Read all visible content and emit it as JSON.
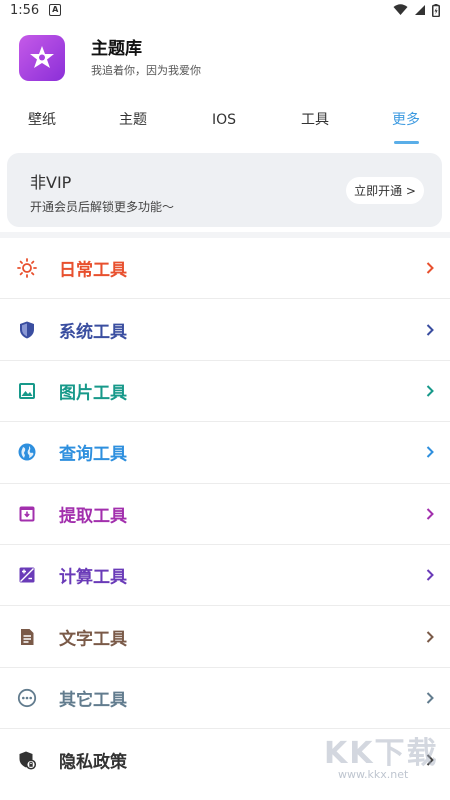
{
  "status_bar": {
    "time": "1:56"
  },
  "app": {
    "title": "主题库",
    "subtitle": "我追着你，因为我爱你"
  },
  "tabs": [
    {
      "label": "壁纸",
      "active": false
    },
    {
      "label": "主题",
      "active": false
    },
    {
      "label": "IOS",
      "active": false
    },
    {
      "label": "工具",
      "active": false
    },
    {
      "label": "更多",
      "active": true
    }
  ],
  "vip": {
    "title": "非VIP",
    "description": "开通会员后解锁更多功能～",
    "button_label": "立即开通 >"
  },
  "menu": [
    {
      "label": "日常工具",
      "color": "#e8502e",
      "icon": "sun-icon"
    },
    {
      "label": "系统工具",
      "color": "#3a4ea0",
      "icon": "shield-icon"
    },
    {
      "label": "图片工具",
      "color": "#17998a",
      "icon": "image-icon"
    },
    {
      "label": "查询工具",
      "color": "#2e8fde",
      "icon": "globe-icon"
    },
    {
      "label": "提取工具",
      "color": "#a22fad",
      "icon": "archive-icon"
    },
    {
      "label": "计算工具",
      "color": "#6a3bb8",
      "icon": "calculator-icon"
    },
    {
      "label": "文字工具",
      "color": "#7a5a48",
      "icon": "document-icon"
    },
    {
      "label": "其它工具",
      "color": "#627c8e",
      "icon": "more-icon"
    },
    {
      "label": "隐私政策",
      "color": "#333333",
      "icon": "privacy-icon"
    }
  ],
  "watermark": {
    "text": "KK下载",
    "url": "www.kkx.net"
  }
}
